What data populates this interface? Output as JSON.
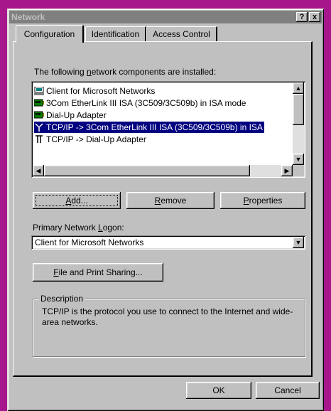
{
  "window": {
    "title": "Network",
    "help_btn": "?",
    "close_btn": "x"
  },
  "tabs": [
    {
      "label": "Configuration"
    },
    {
      "label": "Identification"
    },
    {
      "label": "Access Control"
    }
  ],
  "components": {
    "label_pre": "The following ",
    "label_key": "n",
    "label_post": "etwork components are installed:",
    "items": [
      {
        "icon": "client-icon",
        "text": "Client for Microsoft Networks"
      },
      {
        "icon": "network-adapter-icon",
        "text": "3Com EtherLink III ISA (3C509/3C509b) in ISA mode"
      },
      {
        "icon": "network-adapter-icon",
        "text": "Dial-Up Adapter"
      },
      {
        "icon": "protocol-icon",
        "text": "TCP/IP -> 3Com EtherLink III ISA (3C509/3C509b) in ISA"
      },
      {
        "icon": "protocol-icon",
        "text": "TCP/IP -> Dial-Up Adapter"
      }
    ],
    "selected_index": 3
  },
  "buttons": {
    "add_key": "A",
    "add_rest": "dd...",
    "remove_key": "R",
    "remove_rest": "emove",
    "properties_key": "P",
    "properties_rest": "roperties",
    "file_print_key": "F",
    "file_print_rest": "ile and Print Sharing...",
    "ok": "OK",
    "cancel": "Cancel"
  },
  "logon": {
    "label_pre": "Primary Network ",
    "label_key": "L",
    "label_post": "ogon:",
    "value": "Client for Microsoft Networks"
  },
  "description": {
    "legend": "Description",
    "text": "TCP/IP is the protocol you use to connect to the Internet and wide-area networks."
  },
  "colors": {
    "background": "#a8168c",
    "face": "#c0c0c0",
    "selection": "#000080"
  }
}
